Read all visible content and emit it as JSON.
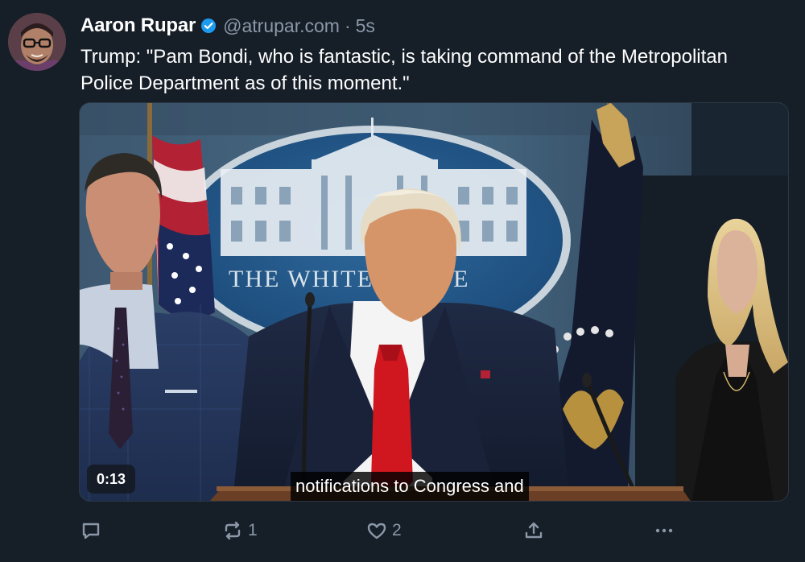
{
  "post": {
    "author_name": "Aaron Rupar",
    "handle": "@atrupar.com",
    "separator": "·",
    "timestamp": "5s",
    "verified": true,
    "text": "Trump: \"Pam Bondi, who is fantastic, is taking command of the Metropolitan Police Department as of this moment.\""
  },
  "video": {
    "duration": "0:13",
    "caption": "notifications to Congress and",
    "backdrop_text": "THE WHITE HOUSE"
  },
  "actions": {
    "reply_icon": "reply-bubble-icon",
    "repost_icon": "repost-icon",
    "repost_count": "1",
    "like_icon": "heart-icon",
    "like_count": "2",
    "share_icon": "share-icon",
    "more_icon": "more-dots-icon"
  },
  "colors": {
    "background": "#161e28",
    "secondary_text": "#8b98a8",
    "verified_blue": "#1d9bf0"
  }
}
